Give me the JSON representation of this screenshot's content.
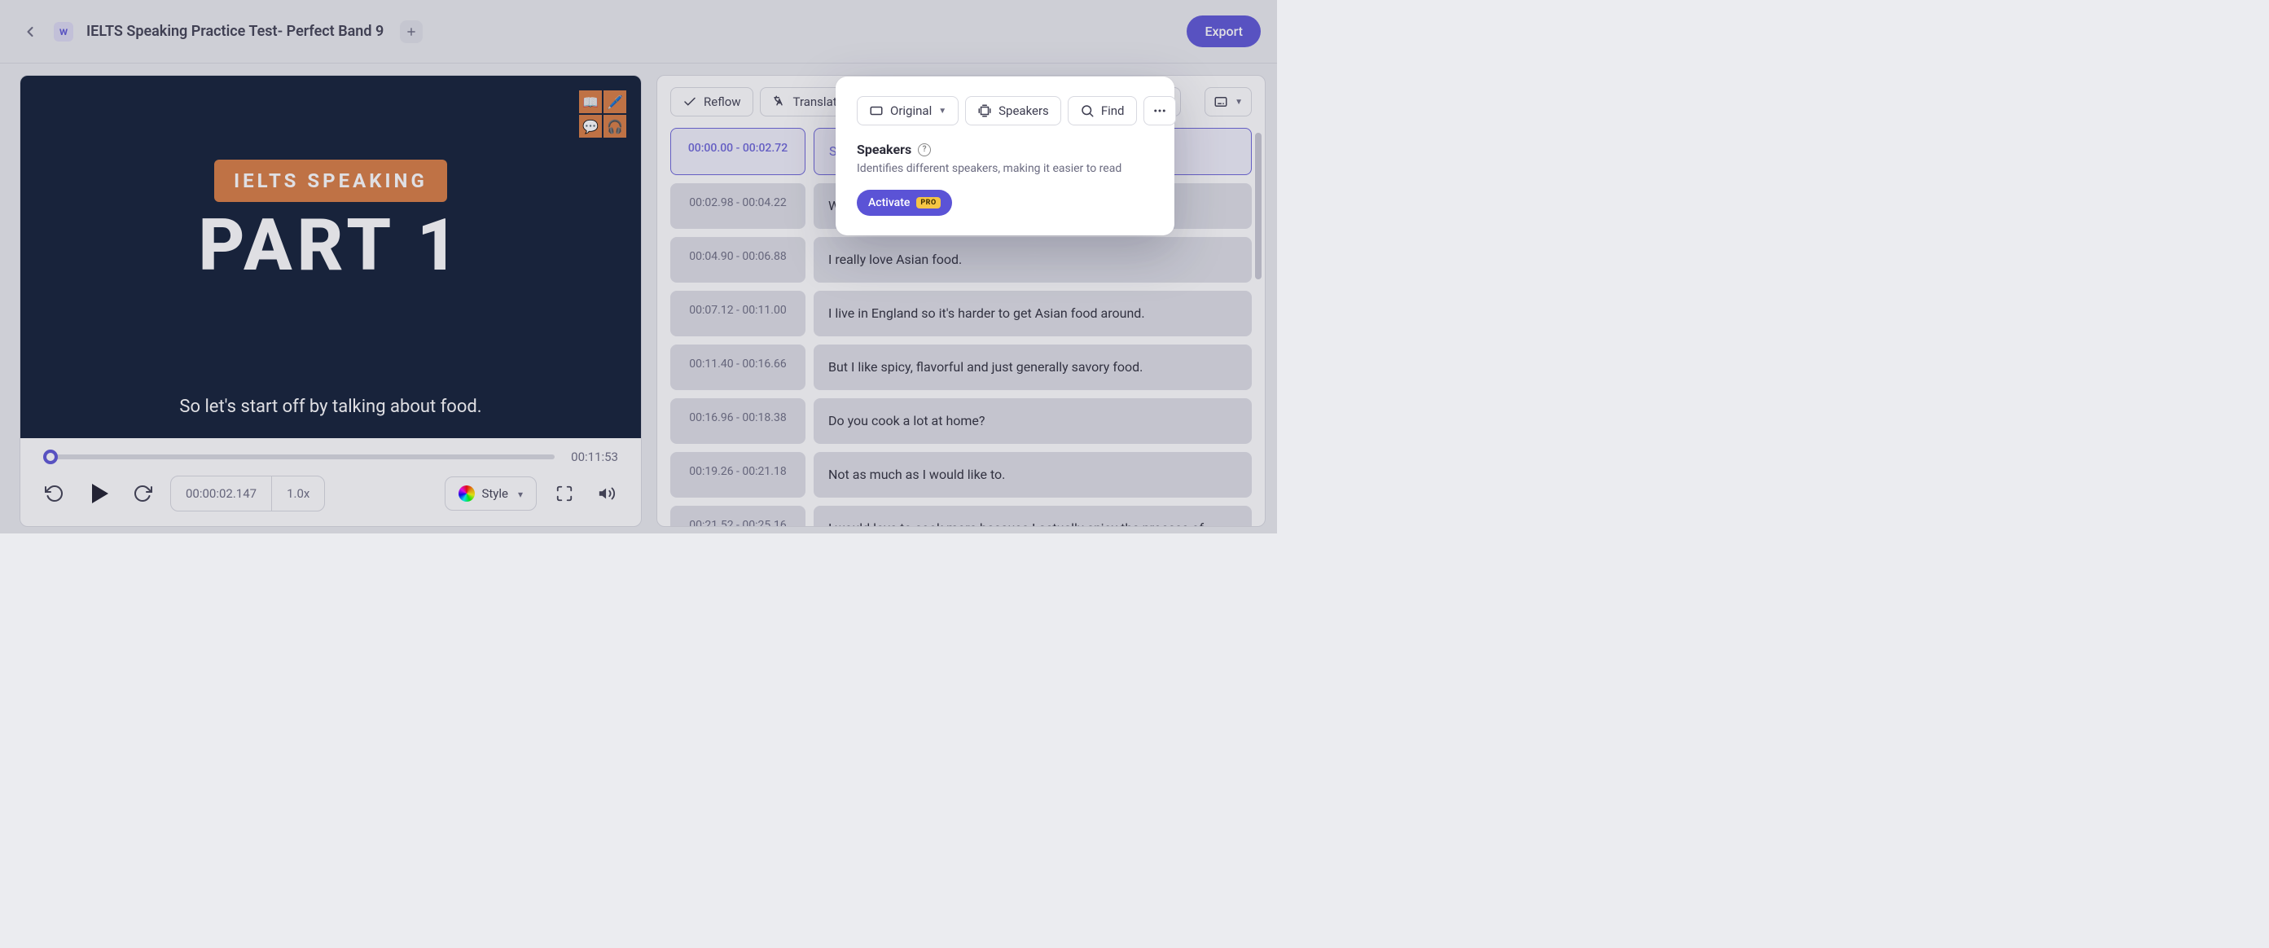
{
  "header": {
    "title": "IELTS Speaking Practice Test- Perfect Band 9",
    "logo_letter": "w",
    "export_label": "Export"
  },
  "video": {
    "pill_text": "IELTS SPEAKING",
    "big_text": "PART 1",
    "caption": "So let's start off by talking about food.",
    "duration": "00:11:53",
    "current_time": "00:00:02.147",
    "rate": "1.0x",
    "style_label": "Style",
    "icons": [
      "book",
      "feather",
      "speech",
      "headphones"
    ]
  },
  "toolbar": {
    "reflow_label": "Reflow",
    "translate_label": "Translate",
    "original_label": "Original",
    "speakers_label": "Speakers",
    "find_label": "Find"
  },
  "popover": {
    "title": "Speakers",
    "subtitle": "Identifies different speakers, making it easier to read",
    "activate_label": "Activate",
    "pro_label": "PRO"
  },
  "transcript": [
    {
      "start": "00:00.00",
      "end": "00:02.72",
      "text": "So let",
      "selected": true
    },
    {
      "start": "00:02.98",
      "end": "00:04.22",
      "text": "What'"
    },
    {
      "start": "00:04.90",
      "end": "00:06.88",
      "text": "I really love Asian food."
    },
    {
      "start": "00:07.12",
      "end": "00:11.00",
      "text": "I live in England so it's harder to get Asian food around."
    },
    {
      "start": "00:11.40",
      "end": "00:16.66",
      "text": "But I like spicy, flavorful and just generally savory food."
    },
    {
      "start": "00:16.96",
      "end": "00:18.38",
      "text": "Do you cook a lot at home?"
    },
    {
      "start": "00:19.26",
      "end": "00:21.18",
      "text": "Not as much as I would like to."
    },
    {
      "start": "00:21.52",
      "end": "00:25.16",
      "text": "I would love to cook more because I actually enjoy the process of cooking."
    }
  ]
}
